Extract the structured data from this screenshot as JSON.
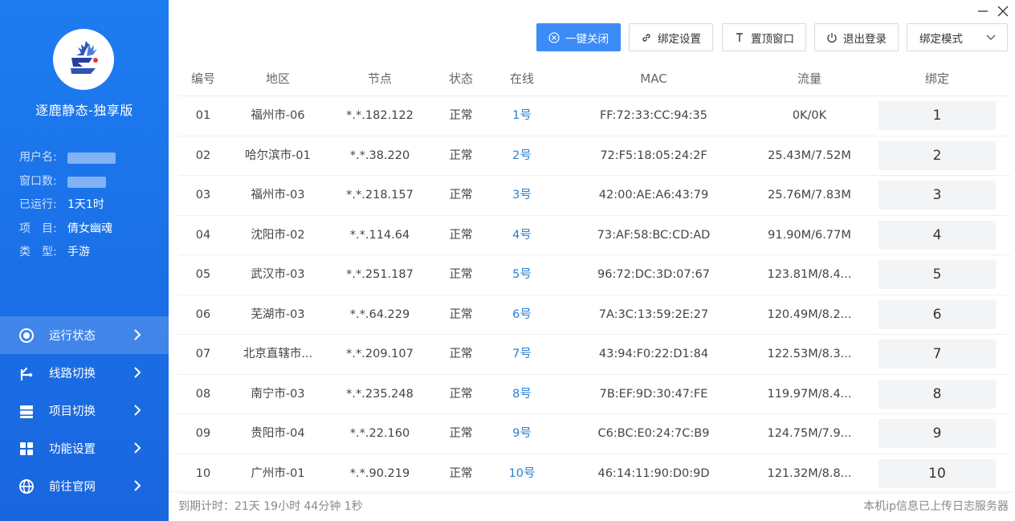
{
  "sidebar": {
    "app_title": "逐鹿静态-独享版",
    "info": {
      "user_label": "用户名:",
      "window_label": "窗口数:",
      "running_label": "已运行:",
      "running_value": "1天1时",
      "project_label": "项　目:",
      "project_value": "倩女幽魂",
      "type_label": "类　型:",
      "type_value": "手游"
    },
    "nav": [
      {
        "label": "运行状态",
        "icon": "status-icon",
        "active": true
      },
      {
        "label": "线路切换",
        "icon": "route-icon"
      },
      {
        "label": "项目切换",
        "icon": "project-icon"
      },
      {
        "label": "功能设置",
        "icon": "settings-icon"
      },
      {
        "label": "前往官网",
        "icon": "globe-icon"
      }
    ]
  },
  "toolbar": {
    "close_all": "一键关闭",
    "bind_settings": "绑定设置",
    "pin_window": "置顶窗口",
    "logout": "退出登录",
    "bind_mode": "绑定模式"
  },
  "table": {
    "headers": [
      "编号",
      "地区",
      "节点",
      "状态",
      "在线",
      "MAC",
      "流量",
      "绑定"
    ],
    "rows": [
      {
        "id": "01",
        "region": "福州市-06",
        "node": "*.*.182.122",
        "status": "正常",
        "online": "1号",
        "mac": "FF:72:33:CC:94:35",
        "traffic": "0K/0K",
        "bind": "1"
      },
      {
        "id": "02",
        "region": "哈尔滨市-01",
        "node": "*.*.38.220",
        "status": "正常",
        "online": "2号",
        "mac": "72:F5:18:05:24:2F",
        "traffic": "25.43M/7.52M",
        "bind": "2"
      },
      {
        "id": "03",
        "region": "福州市-03",
        "node": "*.*.218.157",
        "status": "正常",
        "online": "3号",
        "mac": "42:00:AE:A6:43:79",
        "traffic": "25.76M/7.83M",
        "bind": "3"
      },
      {
        "id": "04",
        "region": "沈阳市-02",
        "node": "*.*.114.64",
        "status": "正常",
        "online": "4号",
        "mac": "73:AF:58:BC:CD:AD",
        "traffic": "91.90M/6.77M",
        "bind": "4"
      },
      {
        "id": "05",
        "region": "武汉市-03",
        "node": "*.*.251.187",
        "status": "正常",
        "online": "5号",
        "mac": "96:72:DC:3D:07:67",
        "traffic": "123.81M/8.4...",
        "bind": "5"
      },
      {
        "id": "06",
        "region": "芜湖市-03",
        "node": "*.*.64.229",
        "status": "正常",
        "online": "6号",
        "mac": "7A:3C:13:59:2E:27",
        "traffic": "120.49M/8.2...",
        "bind": "6"
      },
      {
        "id": "07",
        "region": "北京直辖市...",
        "node": "*.*.209.107",
        "status": "正常",
        "online": "7号",
        "mac": "43:94:F0:22:D1:84",
        "traffic": "122.53M/8.3...",
        "bind": "7"
      },
      {
        "id": "08",
        "region": "南宁市-03",
        "node": "*.*.235.248",
        "status": "正常",
        "online": "8号",
        "mac": "7B:EF:9D:30:47:FE",
        "traffic": "119.97M/8.4...",
        "bind": "8"
      },
      {
        "id": "09",
        "region": "贵阳市-04",
        "node": "*.*.22.160",
        "status": "正常",
        "online": "9号",
        "mac": "C6:BC:E0:24:7C:B9",
        "traffic": "124.75M/7.9...",
        "bind": "9"
      },
      {
        "id": "10",
        "region": "广州市-01",
        "node": "*.*.90.219",
        "status": "正常",
        "online": "10号",
        "mac": "46:14:11:90:D0:9D",
        "traffic": "121.32M/8.8...",
        "bind": "10"
      }
    ]
  },
  "footer": {
    "expiry": "到期计时：21天 19小时 44分钟 1秒",
    "status": "本机ip信息已上传日志服务器"
  },
  "colors": {
    "sidebar": "#1b6fe6",
    "primary_button": "#3b8cf7",
    "online_link": "#2a7fd4"
  }
}
